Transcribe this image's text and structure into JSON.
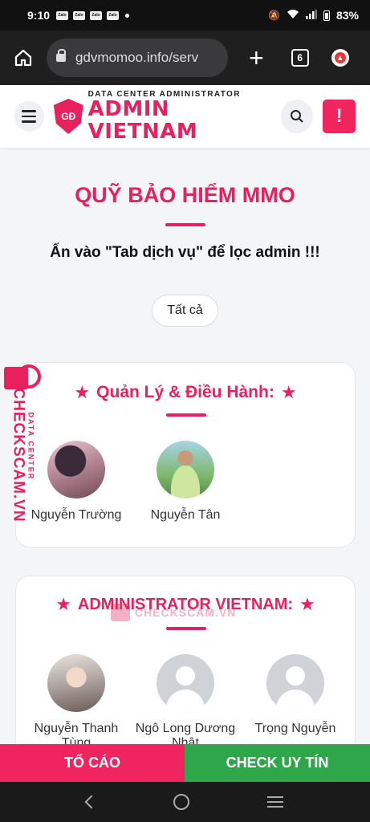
{
  "status": {
    "time": "9:10",
    "notifications": [
      "Zalo",
      "Zalo",
      "Zalo",
      "Zalo"
    ],
    "battery": "83%"
  },
  "browser": {
    "url": "gdvmomoo.info/serv",
    "tab_count": "6"
  },
  "header": {
    "logo_small": "DATA CENTER ADMINISTRATOR",
    "logo_big": "ADMIN VIETNAM",
    "logo_mark": "GĐ",
    "alert_label": "!"
  },
  "main": {
    "title": "QUỸ BẢO HIỂM MMO",
    "subtitle": "Ấn vào \"Tab dịch vụ\" để lọc admin !!!",
    "filter_label": "Tất cả"
  },
  "sections": [
    {
      "title": "Quản Lý & Điều Hành:",
      "members": [
        {
          "name": "Nguyễn Trường"
        },
        {
          "name": "Nguyễn Tân"
        }
      ]
    },
    {
      "title": "ADMINISTRATOR VIETNAM:",
      "members": [
        {
          "name": "Nguyễn Thanh Tùng"
        },
        {
          "name": "Ngô Long Dương Nhật"
        },
        {
          "name": "Trọng Nguyễn"
        }
      ]
    }
  ],
  "side_badge": {
    "main": "CHECKSCAM.VN",
    "small": "DATA CENTER"
  },
  "watermark": "CHECKSCAM.VN",
  "bottom": {
    "report_label": "TỐ CÁO",
    "check_label": "CHECK UY TÍN"
  },
  "colors": {
    "accent": "#e8205d",
    "report": "#f0245e",
    "check": "#2ea64a"
  }
}
